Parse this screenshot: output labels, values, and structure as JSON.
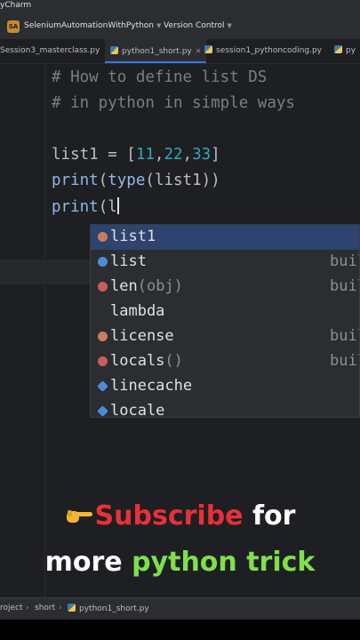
{
  "app": {
    "title": "yCharm"
  },
  "toolbar": {
    "project_badge": "SA",
    "project_name": "SeleniumAutomationWithPython",
    "version_control": "Version Control"
  },
  "tabs": [
    {
      "label": "Session3_masterclass.py"
    },
    {
      "label": "python1_short.py",
      "active": true
    },
    {
      "label": "session1_pythoncoding.py"
    },
    {
      "label": "py"
    }
  ],
  "code": {
    "line1": "# How to define list DS",
    "line2": "# in python in simple ways",
    "line3_var": "list1 = [",
    "line3_n1": "11",
    "line3_n2": "22",
    "line3_n3": "33",
    "line4_fn1": "print",
    "line4_fn2": "type",
    "line4_arg": "list1",
    "line5_fn": "print",
    "line5_typed": "l"
  },
  "autocomplete": {
    "items": [
      {
        "name": "list1",
        "args": "",
        "hint": "",
        "icon": "variable-icon"
      },
      {
        "name": "list",
        "args": "",
        "hint": "buil",
        "icon": "class-icon"
      },
      {
        "name": "len",
        "args": "(obj)",
        "hint": "buil",
        "icon": "function-icon"
      },
      {
        "name": "lambda",
        "args": "",
        "hint": "",
        "icon": "keyword"
      },
      {
        "name": "license",
        "args": "",
        "hint": "buil",
        "icon": "variable-icon"
      },
      {
        "name": "locals",
        "args": "()",
        "hint": "buil",
        "icon": "function-icon"
      },
      {
        "name": "linecache",
        "args": "",
        "hint": "",
        "icon": "module-icon"
      },
      {
        "name": "locale",
        "args": "",
        "hint": "",
        "icon": "module-icon"
      }
    ]
  },
  "promo": {
    "subscribe": "Subscribe",
    "for": "for",
    "more": "more",
    "python_trick": "python trick"
  },
  "breadcrumb": [
    "roject",
    "short",
    "python1_short.py"
  ],
  "colors": {
    "accent": "#3574f0",
    "subscribe_red": "#e8303a",
    "trick_green": "#7ee04a"
  }
}
